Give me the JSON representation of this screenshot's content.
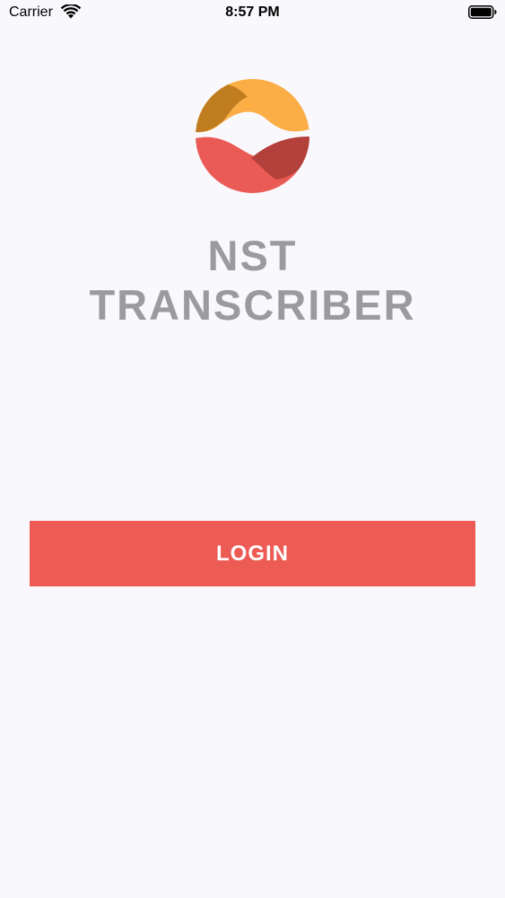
{
  "status_bar": {
    "carrier": "Carrier",
    "time": "8:57 PM"
  },
  "app": {
    "title_line1": "NST",
    "title_line2": "TRANSCRIBER"
  },
  "login": {
    "label": "LOGIN"
  },
  "colors": {
    "accent": "#ED5B55",
    "logo_orange": "#FBAE45",
    "logo_dark_orange": "#C07D1F",
    "logo_dark_red": "#B3403B",
    "title_gray": "#9B9B9D",
    "background": "#F9F8FC"
  },
  "icons": {
    "wifi": "wifi-icon",
    "battery": "battery-icon",
    "logo": "app-logo"
  }
}
